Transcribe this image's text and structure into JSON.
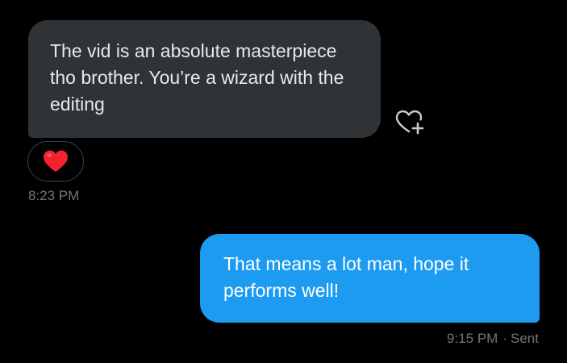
{
  "conversation": {
    "received": {
      "text": "The vid is an absolute masterpiece tho brother. You’re a wizard with the editing",
      "reaction": "❤️",
      "timestamp": "8:23 PM"
    },
    "react_button_icon": "heart-plus-icon",
    "sent": {
      "text": "That means a lot man, hope it performs well!",
      "timestamp": "9:15 PM",
      "separator": "·",
      "status": "Sent"
    }
  },
  "colors": {
    "background": "#000000",
    "received_bubble": "#2f3336",
    "sent_bubble": "#1d9bf0",
    "meta_text": "#71767b",
    "heart": "#f4212e"
  }
}
